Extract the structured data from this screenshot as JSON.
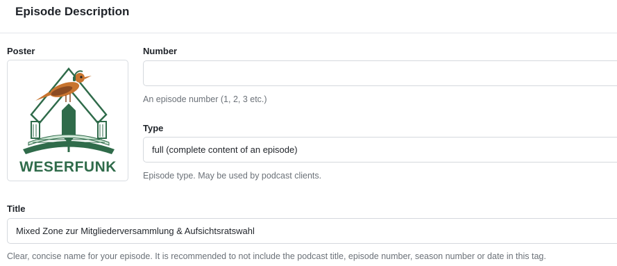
{
  "header": {
    "title": "Episode Description"
  },
  "poster": {
    "label": "Poster",
    "logo_text": "WESERFUNK"
  },
  "number": {
    "label": "Number",
    "value": "",
    "placeholder": "",
    "help": "An episode number (1, 2, 3 etc.)"
  },
  "type": {
    "label": "Type",
    "selected": "full (complete content of an episode)",
    "help": "Episode type. May be used by podcast clients."
  },
  "title": {
    "label": "Title",
    "value": "Mixed Zone zur Mitgliederversammlung & Aufsichtsratswahl",
    "help": "Clear, concise name for your episode. It is recommended to not include the podcast title, episode number, season number or date in this tag."
  },
  "colors": {
    "logo_green": "#2f6b4a",
    "bird_orange": "#c8742f",
    "border": "#d4d8dd",
    "help_text": "#6b7178"
  }
}
